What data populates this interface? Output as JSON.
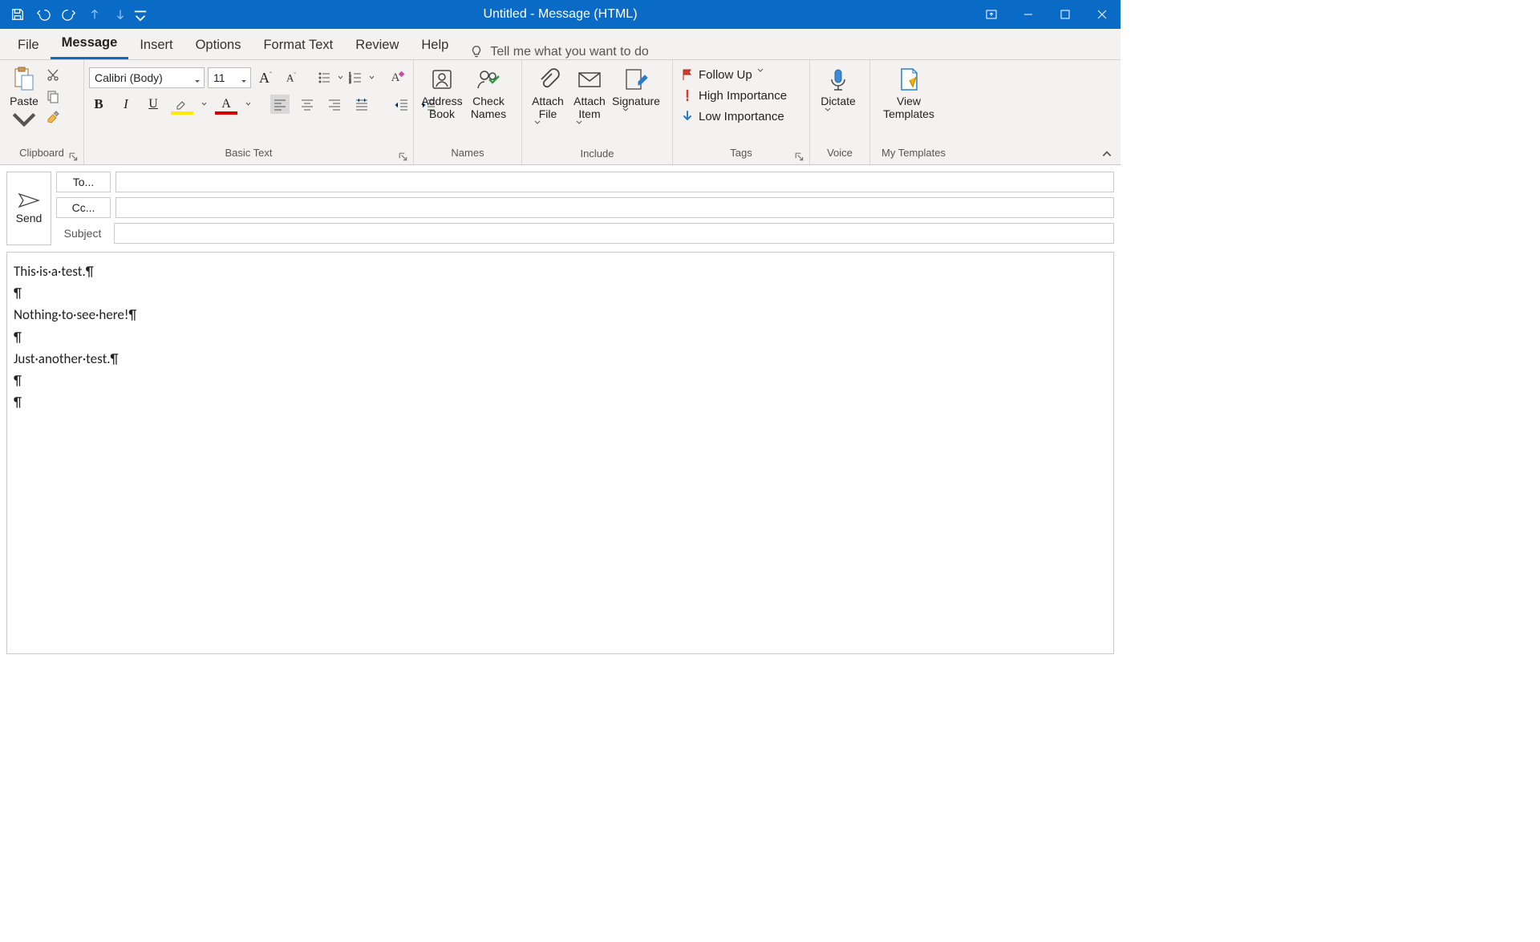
{
  "window": {
    "title": "Untitled  -  Message (HTML)"
  },
  "qat_icons": [
    "save",
    "undo",
    "redo",
    "prev",
    "next",
    "more"
  ],
  "tabs": [
    "File",
    "Message",
    "Insert",
    "Options",
    "Format Text",
    "Review",
    "Help"
  ],
  "active_tab": "Message",
  "tellme": "Tell me what you want to do",
  "ribbon": {
    "clipboard": {
      "label": "Clipboard",
      "paste": "Paste"
    },
    "basic_text": {
      "label": "Basic Text",
      "font_name": "Calibri (Body)",
      "font_size": "11"
    },
    "names": {
      "label": "Names",
      "address_book": "Address Book",
      "check_names": "Check Names"
    },
    "include": {
      "label": "Include",
      "attach_file": "Attach File",
      "attach_item": "Attach Item",
      "signature": "Signature"
    },
    "tags": {
      "label": "Tags",
      "follow_up": "Follow Up",
      "high": "High Importance",
      "low": "Low Importance"
    },
    "voice": {
      "label": "Voice",
      "dictate": "Dictate"
    },
    "templates": {
      "label": "My Templates",
      "view": "View Templates"
    }
  },
  "compose": {
    "send": "Send",
    "to_btn": "To...",
    "cc_btn": "Cc...",
    "subject_label": "Subject",
    "to_value": "",
    "cc_value": "",
    "subject_value": ""
  },
  "body_lines": [
    "This·is·a·test.¶",
    "¶",
    "Nothing·to·see·here!¶",
    "¶",
    "Just·another·test.¶",
    "¶",
    "¶"
  ]
}
